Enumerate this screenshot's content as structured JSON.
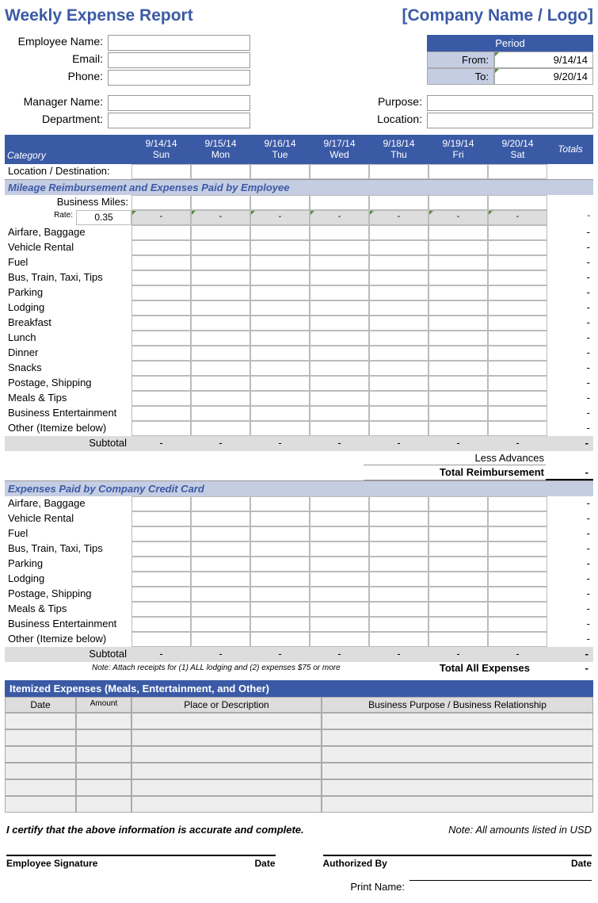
{
  "header": {
    "title": "Weekly Expense Report",
    "company": "[Company Name / Logo]"
  },
  "employee": {
    "name_lbl": "Employee Name:",
    "email_lbl": "Email:",
    "phone_lbl": "Phone:"
  },
  "period": {
    "header": "Period",
    "from_lbl": "From:",
    "from_val": "9/14/14",
    "to_lbl": "To:",
    "to_val": "9/20/14"
  },
  "manager": {
    "name_lbl": "Manager Name:",
    "dept_lbl": "Department:"
  },
  "purpose": {
    "purpose_lbl": "Purpose:",
    "location_lbl": "Location:"
  },
  "cols": {
    "category": "Category",
    "days": [
      {
        "date": "9/14/14",
        "dow": "Sun"
      },
      {
        "date": "9/15/14",
        "dow": "Mon"
      },
      {
        "date": "9/16/14",
        "dow": "Tue"
      },
      {
        "date": "9/17/14",
        "dow": "Wed"
      },
      {
        "date": "9/18/14",
        "dow": "Thu"
      },
      {
        "date": "9/19/14",
        "dow": "Fri"
      },
      {
        "date": "9/20/14",
        "dow": "Sat"
      }
    ],
    "totals": "Totals"
  },
  "loc_dest": "Location / Destination:",
  "sec1": {
    "header": "Mileage Reimbursement and Expenses Paid by Employee",
    "business_miles": "Business Miles:",
    "rate_lbl": "Rate:",
    "rate_val": "0.35",
    "rows": [
      "Airfare, Baggage",
      "Vehicle Rental",
      "Fuel",
      "Bus, Train, Taxi, Tips",
      "Parking",
      "Lodging",
      "Breakfast",
      "Lunch",
      "Dinner",
      "Snacks",
      "Postage, Shipping",
      "Meals & Tips",
      "Business Entertainment",
      "Other (Itemize below)"
    ],
    "subtotal_lbl": "Subtotal",
    "less_adv": "Less Advances",
    "total_reimb": "Total Reimbursement"
  },
  "sec2": {
    "header": "Expenses Paid by Company Credit Card",
    "rows": [
      "Airfare, Baggage",
      "Vehicle Rental",
      "Fuel",
      "Bus, Train, Taxi, Tips",
      "Parking",
      "Lodging",
      "Postage, Shipping",
      "Meals & Tips",
      "Business Entertainment",
      "Other (Itemize below)"
    ],
    "subtotal_lbl": "Subtotal",
    "note": "Note:  Attach receipts for (1) ALL lodging and (2) expenses $75 or more",
    "total_all": "Total All Expenses"
  },
  "itemized": {
    "header": "Itemized Expenses (Meals, Entertainment, and Other)",
    "cols": {
      "date": "Date",
      "amount": "Amount",
      "place": "Place or Description",
      "purpose": "Business Purpose / Business Relationship"
    },
    "row_count": 6
  },
  "footer": {
    "certify": "I certify that the above information is accurate and complete.",
    "note_usd": "Note: All amounts listed in USD",
    "emp_sig": "Employee Signature",
    "date": "Date",
    "auth_by": "Authorized By",
    "print_name": "Print Name:"
  },
  "dash": "-"
}
